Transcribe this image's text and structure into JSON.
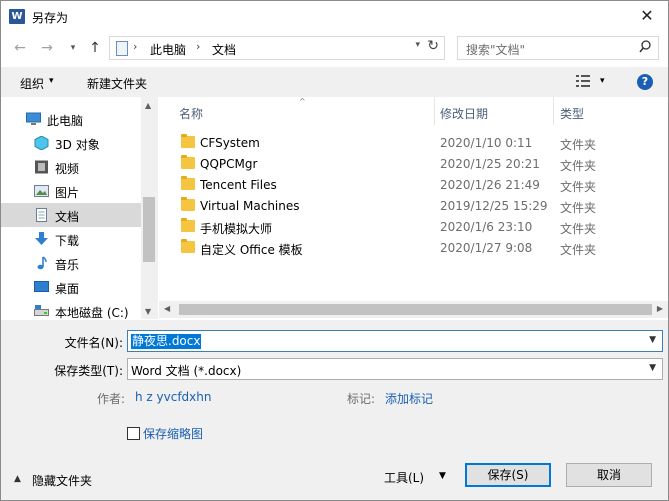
{
  "window": {
    "title": "另存为",
    "app_icon": "W",
    "close_glyph": "✕"
  },
  "nav": {
    "back": "←",
    "forward": "→",
    "recent": "▾",
    "up": "↑"
  },
  "address": {
    "segments": [
      "此电脑",
      "文档"
    ],
    "separator": "›",
    "dropdown": "▾",
    "refresh": "↻"
  },
  "search": {
    "placeholder": "搜索\"文档\""
  },
  "toolbar": {
    "organize": "组织",
    "caret": "▾",
    "new_folder": "新建文件夹",
    "help": "?"
  },
  "sidebar": {
    "items": [
      {
        "label": "此电脑",
        "icon": "computer-icon"
      },
      {
        "label": "3D 对象",
        "icon": "3d-objects-icon"
      },
      {
        "label": "视频",
        "icon": "video-icon"
      },
      {
        "label": "图片",
        "icon": "pictures-icon"
      },
      {
        "label": "文档",
        "icon": "documents-icon",
        "selected": true
      },
      {
        "label": "下载",
        "icon": "download-icon"
      },
      {
        "label": "音乐",
        "icon": "music-icon"
      },
      {
        "label": "桌面",
        "icon": "desktop-icon"
      },
      {
        "label": "本地磁盘 (C:)",
        "icon": "drive-icon"
      }
    ]
  },
  "filelist": {
    "columns": {
      "name": "名称",
      "date": "修改日期",
      "type": "类型"
    },
    "sort_indicator": "^",
    "rows": [
      {
        "name": "CFSystem",
        "date": "2020/1/10 0:11",
        "type": "文件夹"
      },
      {
        "name": "QQPCMgr",
        "date": "2020/1/25 20:21",
        "type": "文件夹"
      },
      {
        "name": "Tencent Files",
        "date": "2020/1/26 21:49",
        "type": "文件夹"
      },
      {
        "name": "Virtual Machines",
        "date": "2019/12/25 15:29",
        "type": "文件夹"
      },
      {
        "name": "手机模拟大师",
        "date": "2020/1/6 23:10",
        "type": "文件夹"
      },
      {
        "name": "自定义 Office 模板",
        "date": "2020/1/27 9:08",
        "type": "文件夹"
      }
    ]
  },
  "scroll_glyphs": {
    "up": "▲",
    "down": "▼",
    "left": "◀",
    "right": "▶"
  },
  "form": {
    "filename_label": "文件名(N):",
    "filename_value": "静夜思.docx",
    "filetype_label": "保存类型(T):",
    "filetype_value": "Word 文档 (*.docx)",
    "author_label": "作者:",
    "author_value": "h z yvcfdxhn",
    "tags_label": "标记:",
    "tags_value": "添加标记",
    "thumbnail_label": "保存缩略图",
    "hide_folders": "隐藏文件夹",
    "tools": "工具(L)",
    "save": "保存(S)",
    "cancel": "取消",
    "caret_up": "▲",
    "caret_down": "▼"
  },
  "colors": {
    "accent": "#0078d7",
    "link": "#1a5fb4",
    "chrome": "#f0f0f0",
    "folder": "#f5c542"
  }
}
